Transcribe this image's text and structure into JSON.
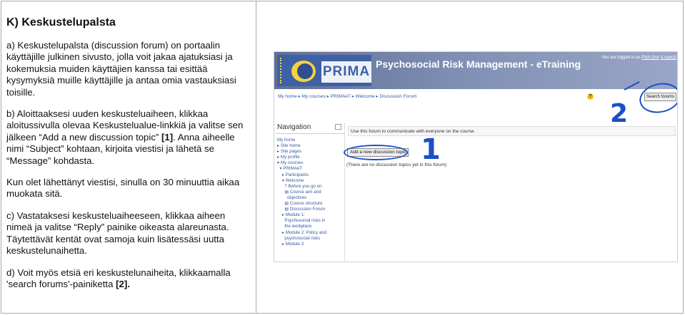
{
  "doc": {
    "heading": "K) Keskustelupalsta",
    "para_a": "a) Keskustelupalsta (discussion forum) on portaalin käyttäjille julkinen sivusto, jolla voit jakaa ajatuksiasi ja kokemuksia muiden käyttäjien kanssa tai esittää kysymyksiä muille käyttäjille ja antaa omia vastauksiasi toisille.",
    "para_b_text": "b) Aloittaaksesi uuden keskusteluaiheen, klikkaa aloitussivulla olevaa Keskustelualue-linkkiä ja valitse sen jälkeen “Add a new discussion topic” ",
    "para_b_ref": "[1]",
    "para_b_tail": ". Anna aiheelle nimi “Subject” kohtaan, kirjoita viestisi ja lähetä se “Message” kohdasta.",
    "para_time": "Kun olet lähettänyt viestisi, sinulla on 30 minuuttia aikaa muokata sitä.",
    "para_c": "c) Vastataksesi keskusteluaiheeseen, klikkaa aiheen nimeä ja valitse “Reply” painike oikeasta alareunasta. Täytettävät kentät ovat samoja kuin lisätessäsi uutta keskustelunaihetta.",
    "para_d_text": "d) Voit myös etsiä eri keskustelunaiheita, klikkaamalla 'search forums'-painiketta ",
    "para_d_ref": "[2]."
  },
  "screenshot": {
    "logo_text": "PRIMA",
    "site_title": "Psychosocial Risk Management - eTraining",
    "login_prefix": "You are logged in as",
    "login_user": "Pilot One",
    "login_action": "(Logout)",
    "breadcrumb": "My home ▸ My courses ▸ PRIMAeT ▸ Welcome ▸ Discussion Forum",
    "search_button": "Search forums",
    "help_glyph": "?",
    "callout_1": "1",
    "callout_2": "2",
    "nav_title": "Navigation",
    "nav_items": [
      "My home",
      "▸ Site home",
      "▸ Site pages",
      "▸ My profile",
      "▾ My courses",
      "  ▾ PRIMAeT",
      "    ▸ Participants",
      "    ▾ Welcome",
      "      ? Before you go on",
      "      ▤ Course aim and",
      "        objectives",
      "      ▤ Course structure",
      "      ▤ Discussion Forum",
      "    ▸ Module 1:",
      "      Psychosocial risks in",
      "      the workplace",
      "    ▸ Module 2: Policy and",
      "      psychosocial risks",
      "    ▸ Module 3"
    ],
    "forum_intro": "Use this forum to communicate with everyone on the course",
    "add_topic_button": "Add a new discussion topic",
    "no_topics": "(There are no discussion topics yet in this forum)"
  }
}
